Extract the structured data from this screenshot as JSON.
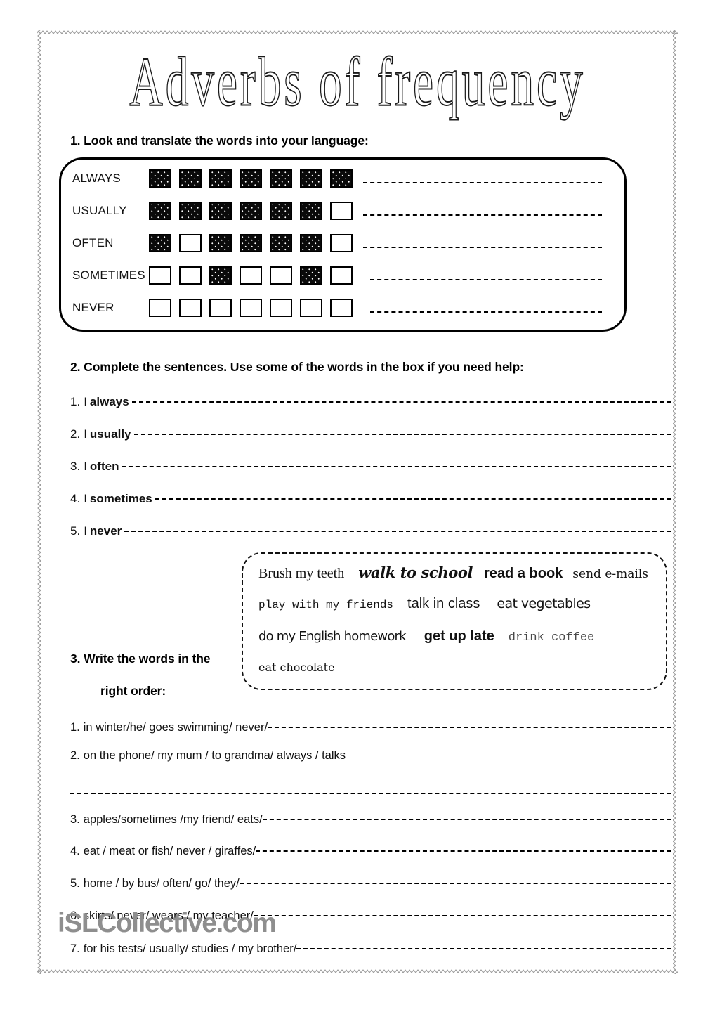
{
  "title": "Adverbs of frequency",
  "watermark": "iSLCollective.com",
  "exercise1": {
    "heading": "1. Look and translate the words into your language:",
    "rows": [
      {
        "label": "ALWAYS",
        "pattern": [
          1,
          1,
          1,
          1,
          1,
          1,
          1
        ]
      },
      {
        "label": "USUALLY",
        "pattern": [
          1,
          1,
          1,
          1,
          1,
          1,
          0
        ]
      },
      {
        "label": "OFTEN",
        "pattern": [
          1,
          0,
          1,
          1,
          1,
          1,
          0
        ]
      },
      {
        "label": "SOMETIMES",
        "pattern": [
          0,
          0,
          1,
          0,
          0,
          1,
          0
        ]
      },
      {
        "label": "NEVER",
        "pattern": [
          0,
          0,
          0,
          0,
          0,
          0,
          0
        ]
      }
    ]
  },
  "exercise2": {
    "heading": "2. Complete the sentences. Use some of the words in the box if you need help:",
    "sentences": [
      {
        "num": "1.",
        "stem": "I",
        "adverb": "always"
      },
      {
        "num": "2.",
        "stem": "I",
        "adverb": "usually"
      },
      {
        "num": "3.",
        "stem": "I",
        "adverb": "often"
      },
      {
        "num": "4.",
        "stem": "I",
        "adverb": "sometimes"
      },
      {
        "num": "5.",
        "stem": "I",
        "adverb": "never"
      }
    ]
  },
  "word_bank": {
    "lines": [
      [
        {
          "text": "Brush my teeth",
          "style": "bk-serif"
        },
        {
          "text": "walk to school",
          "style": "bk-script"
        },
        {
          "text": "read a book",
          "style": "bk-sansbold"
        },
        {
          "text": "send e-mails",
          "style": "bk-thin"
        }
      ],
      [
        {
          "text": "play with my friends",
          "style": "bk-mono"
        },
        {
          "text": "talk in class",
          "style": "bk-sans"
        },
        {
          "text": "eat vegetables",
          "style": "bk-round"
        }
      ],
      [
        {
          "text": "do my English homework",
          "style": "bk-narrow"
        },
        {
          "text": "get up late",
          "style": "bk-sansbold"
        },
        {
          "text": "drink coffee",
          "style": "bk-monolight"
        }
      ],
      [
        {
          "text": "eat chocolate",
          "style": "bk-smallserif"
        }
      ]
    ]
  },
  "exercise3": {
    "heading_line1": "3. Write the words in the",
    "heading_line2": "right order:",
    "items": [
      {
        "num": "1.",
        "text": "in winter/he/ goes swimming/  never/",
        "line_below": false
      },
      {
        "num": "2.",
        "text": "on the phone/ my mum / to grandma/ always / talks",
        "line_below": true
      },
      {
        "num": "3.",
        "text": "apples/sometimes /my friend/ eats/ ",
        "line_below": false
      },
      {
        "num": "4.",
        "text": "eat / meat or fish/ never / giraffes/",
        "line_below": false
      },
      {
        "num": "5.",
        "text": "home /  by bus/ often/ go/ they/",
        "line_below": false
      },
      {
        "num": "6.",
        "text": "skirts/ never/ wears / my teacher/",
        "line_below": false
      },
      {
        "num": "7.",
        "text": "for his tests/ usually/ studies / my brother/",
        "line_below": false
      }
    ]
  }
}
